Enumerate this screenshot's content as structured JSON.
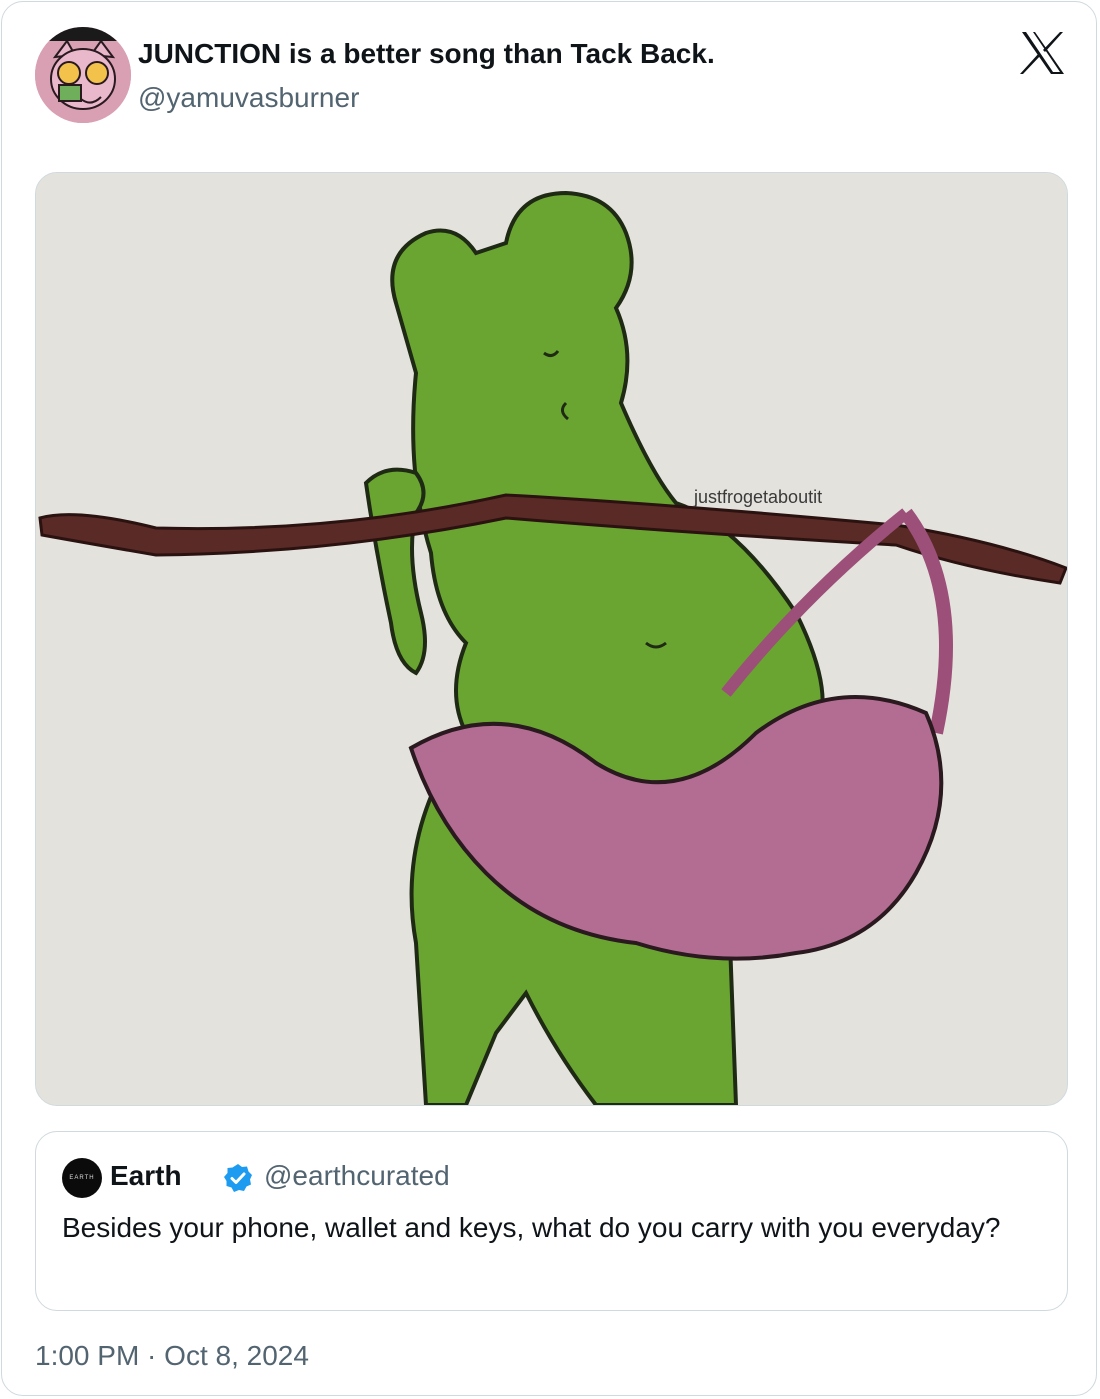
{
  "tweet": {
    "display_name": "JUNCTION is a better song than Tack Back.",
    "handle": "@yamuvasburner",
    "media_watermark": "justfrogetaboutit",
    "timestamp": "1:00 PM · Oct 8, 2024"
  },
  "quoted_tweet": {
    "display_name": "Earth",
    "handle": "@earthcurated",
    "avatar_text": "EARTH",
    "verified": true,
    "text": "Besides your phone, wallet and keys, what do you carry with you everyday?"
  },
  "colors": {
    "text_primary": "#0f1419",
    "text_secondary": "#536471",
    "border": "#cfd9de",
    "verified_blue": "#1d9bf0",
    "frog_green": "#6aa531",
    "bag_pink": "#b46d92",
    "stick_brown": "#5a2a26"
  },
  "icons": [
    "x-logo-icon",
    "verified-badge-icon"
  ]
}
